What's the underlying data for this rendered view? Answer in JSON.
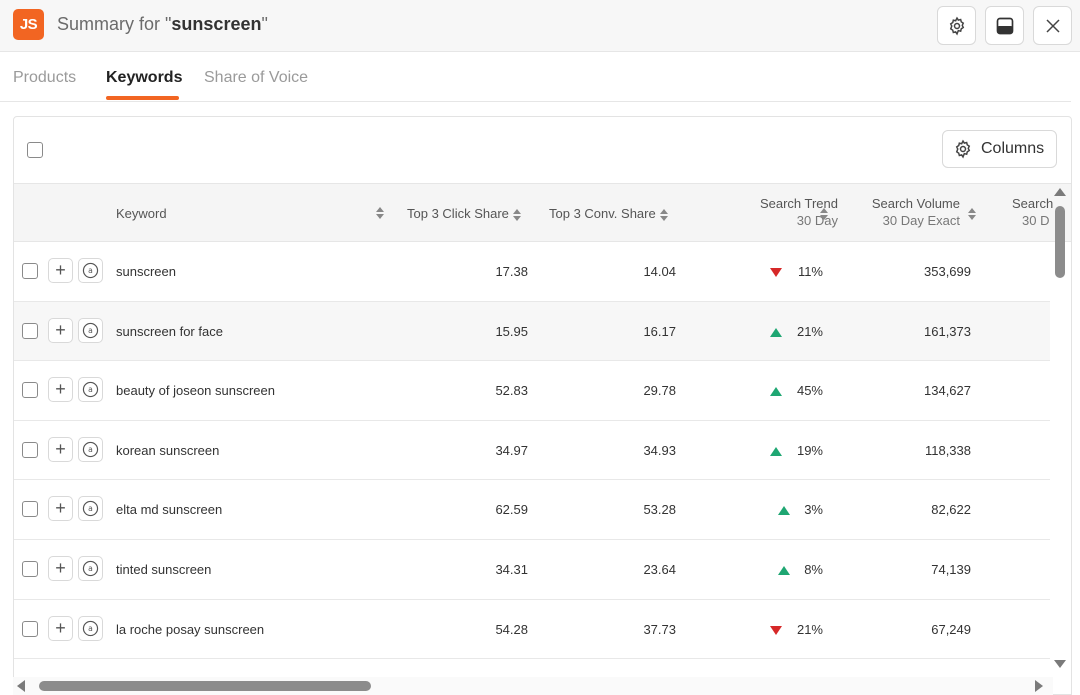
{
  "header": {
    "logo_text": "JS",
    "title_prefix": "Summary for \"",
    "title_keyword": "sunscreen",
    "title_suffix": "\"",
    "accent": "#f26522"
  },
  "tabs": [
    {
      "label": "Products",
      "active": false
    },
    {
      "label": "Keywords",
      "active": true
    },
    {
      "label": "Share of Voice",
      "active": false
    }
  ],
  "toolbar": {
    "columns_label": "Columns"
  },
  "columns": {
    "keyword": "Keyword",
    "click_share": "Top 3 Click Share",
    "conv_share": "Top 3 Conv. Share",
    "trend": "Search Trend",
    "trend_sub": "30 Day",
    "volume": "Search Volume",
    "volume_sub": "30 Day Exact",
    "next": "Search",
    "next_sub": "30 D"
  },
  "rows": [
    {
      "keyword": "sunscreen",
      "click_share": "17.38",
      "conv_share": "14.04",
      "trend_dir": "down",
      "trend": "11%",
      "volume": "353,699"
    },
    {
      "keyword": "sunscreen for face",
      "click_share": "15.95",
      "conv_share": "16.17",
      "trend_dir": "up",
      "trend": "21%",
      "volume": "161,373"
    },
    {
      "keyword": "beauty of joseon sunscreen",
      "click_share": "52.83",
      "conv_share": "29.78",
      "trend_dir": "up",
      "trend": "45%",
      "volume": "134,627"
    },
    {
      "keyword": "korean sunscreen",
      "click_share": "34.97",
      "conv_share": "34.93",
      "trend_dir": "up",
      "trend": "19%",
      "volume": "118,338"
    },
    {
      "keyword": "elta md sunscreen",
      "click_share": "62.59",
      "conv_share": "53.28",
      "trend_dir": "up",
      "trend": "3%",
      "volume": "82,622"
    },
    {
      "keyword": "tinted sunscreen",
      "click_share": "34.31",
      "conv_share": "23.64",
      "trend_dir": "up",
      "trend": "8%",
      "volume": "74,139"
    },
    {
      "keyword": "la roche posay sunscreen",
      "click_share": "54.28",
      "conv_share": "37.73",
      "trend_dir": "down",
      "trend": "21%",
      "volume": "67,249"
    }
  ],
  "colors": {
    "up": "#1ea672",
    "down": "#d62828"
  }
}
